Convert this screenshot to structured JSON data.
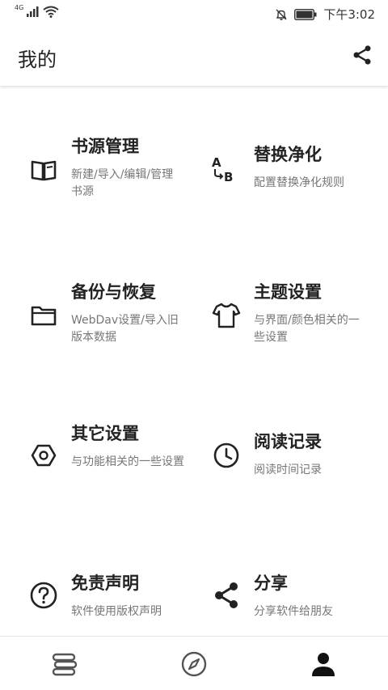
{
  "status_bar": {
    "network": "4G",
    "time": "下午3:02"
  },
  "header": {
    "title": "我的"
  },
  "menu": [
    {
      "title": "书源管理",
      "desc": "新建/导入/编辑/管理书源",
      "icon": "book-open-icon"
    },
    {
      "title": "替换净化",
      "desc": "配置替换净化规则",
      "icon": "text-replace-icon"
    },
    {
      "title": "备份与恢复",
      "desc": "WebDav设置/导入旧版本数据",
      "icon": "folder-icon"
    },
    {
      "title": "主题设置",
      "desc": "与界面/颜色相关的一些设置",
      "icon": "tshirt-icon"
    },
    {
      "title": "其它设置",
      "desc": "与功能相关的一些设置",
      "icon": "hexagon-settings-icon"
    },
    {
      "title": "阅读记录",
      "desc": "阅读时间记录",
      "icon": "clock-icon"
    },
    {
      "title": "免责声明",
      "desc": "软件使用版权声明",
      "icon": "help-circle-icon"
    },
    {
      "title": "分享",
      "desc": "分享软件给朋友",
      "icon": "share-icon"
    }
  ],
  "bottom_nav": [
    {
      "name": "bookshelf",
      "icon": "bookshelf-icon"
    },
    {
      "name": "explore",
      "icon": "compass-icon"
    },
    {
      "name": "my",
      "icon": "person-icon",
      "active": true
    }
  ],
  "colors": {
    "text": "#222222",
    "secondary": "#777777",
    "icon": "#222222",
    "inactive_nav": "#555555"
  }
}
